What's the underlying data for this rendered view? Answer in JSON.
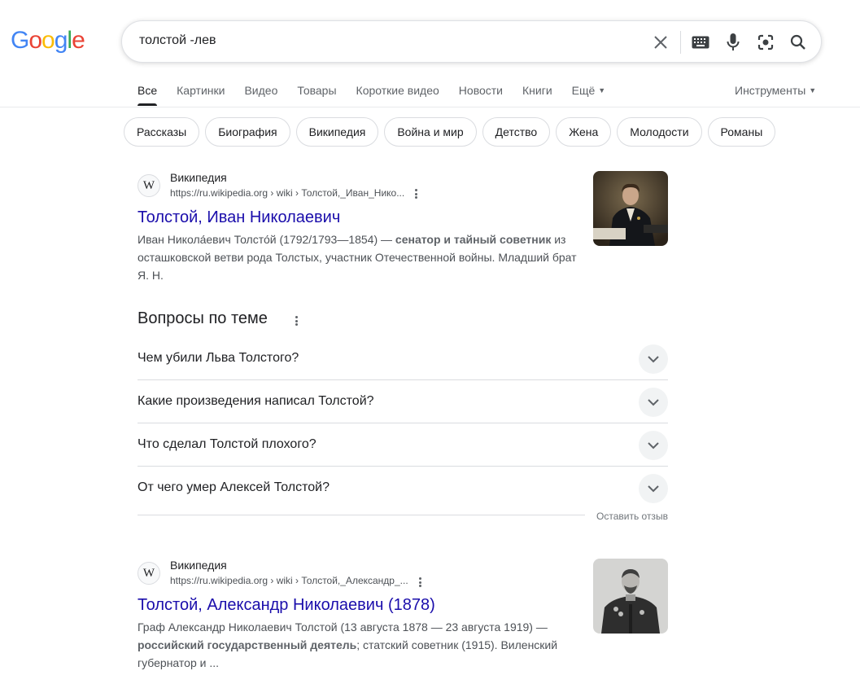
{
  "logo": {
    "letters": [
      {
        "ch": "G",
        "color": "#4285F4"
      },
      {
        "ch": "o",
        "color": "#EA4335"
      },
      {
        "ch": "o",
        "color": "#FBBC05"
      },
      {
        "ch": "g",
        "color": "#4285F4"
      },
      {
        "ch": "l",
        "color": "#34A853"
      },
      {
        "ch": "e",
        "color": "#EA4335"
      }
    ]
  },
  "search": {
    "query": "толстой -лев",
    "icons": [
      "close-icon",
      "keyboard-icon",
      "mic-icon",
      "lens-icon",
      "search-icon"
    ]
  },
  "tabs": [
    {
      "label": "Все",
      "active": true
    },
    {
      "label": "Картинки"
    },
    {
      "label": "Видео"
    },
    {
      "label": "Товары"
    },
    {
      "label": "Короткие видео"
    },
    {
      "label": "Новости"
    },
    {
      "label": "Книги"
    },
    {
      "label": "Ещё",
      "dropdown": true
    }
  ],
  "tools_label": "Инструменты",
  "chips": [
    "Рассказы",
    "Биография",
    "Википедия",
    "Война и мир",
    "Детство",
    "Жена",
    "Молодости",
    "Романы"
  ],
  "results": [
    {
      "favicon": "W",
      "source": "Википедия",
      "url": "https://ru.wikipedia.org › wiki › Толстой,_Иван_Нико...",
      "title": "Толстой, Иван Николаевич",
      "snippet_pre": "Иван Никола́евич Толсто́й (1792/1793—1854) — ",
      "snippet_bold": "сенатор и тайный советник",
      "snippet_post": " из осташковской ветви рода Толстых, участник Отечественной войны. Младший брат Я. Н.",
      "thumb": "portrait-painting"
    },
    {
      "favicon": "W",
      "source": "Википедия",
      "url": "https://ru.wikipedia.org › wiki › Толстой,_Александр_...",
      "title": "Толстой, Александр Николаевич (1878)",
      "snippet_pre": "Граф Александр Николаевич Толстой (13 августа 1878 — 23 августа 1919) — ",
      "snippet_bold": "российский государственный деятель",
      "snippet_post": "; статский советник (1915). Виленский губернатор и ...",
      "thumb": "portrait-photo"
    }
  ],
  "paa": {
    "title": "Вопросы по теме",
    "questions": [
      "Чем убили Льва Толстого?",
      "Какие произведения написал Толстой?",
      "Что сделал Толстой плохого?",
      "От чего умер Алексей Толстой?"
    ],
    "feedback": "Оставить отзыв"
  },
  "colors": {
    "link": "#1a0dab",
    "text": "#202124",
    "muted": "#5f6368"
  }
}
